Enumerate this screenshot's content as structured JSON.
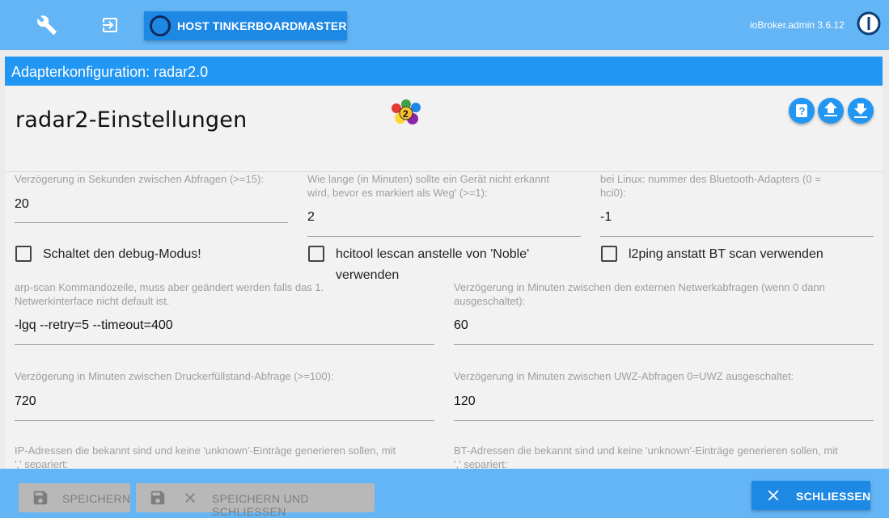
{
  "topbar": {
    "host_label": "HOST TINKERBOARDMASTER",
    "version": "ioBroker.admin 3.6.12",
    "icons": [
      "wrench-icon",
      "logout-icon",
      "iobroker-logo"
    ]
  },
  "page": {
    "title": "Adapterkonfiguration: radar2.0",
    "settings_title": "radar2-Einstellungen",
    "action_icons": [
      "help-icon",
      "upload-icon",
      "download-icon"
    ]
  },
  "fields": {
    "delay": {
      "label": "Verzögerung in Sekunden zwischen Abfragen (>=15):",
      "value": "20"
    },
    "away": {
      "label_l1": "Wie lange (in Minuten) sollte ein Gerät nicht erkannt",
      "label_l2": "wird, bevor es markiert als Weg' (>=1):",
      "value": "2"
    },
    "btadapter": {
      "label_l1": "bei Linux: nummer des Bluetooth-Adapters (0 =",
      "label_l2": "hci0):",
      "value": "-1"
    },
    "arpscan": {
      "label_l1": "arp-scan Kommandozeile, muss aber geändert werden falls das 1.",
      "label_l2": "Netwerkinterface nicht default ist.",
      "value": "-lgq --retry=5 --timeout=400"
    },
    "external": {
      "label_l1": "Verzögerung in Minuten zwischen den externen Netwerkabfragen (wenn 0 dann",
      "label_l2": "ausgeschaltet):",
      "value": "60"
    },
    "printer": {
      "label": "Verzögerung in Minuten zwischen Druckerfüllstand-Abfrage (>=100):",
      "value": "720"
    },
    "uwz": {
      "label": "Verzögerung in Minuten zwischen UWZ-Abfragen 0=UWZ ausgeschaltet:",
      "value": "120"
    },
    "knownip": {
      "label_l1": "IP-Adressen die bekannt sind und keine 'unknown'-Einträge generieren sollen, mit",
      "label_l2": "',' separiert:"
    },
    "knownbt": {
      "label_l1": "BT-Adressen die bekannt sind und keine 'unknown'-Einträge generieren sollen, mit",
      "label_l2": "',' separiert:"
    }
  },
  "checkboxes": {
    "debug": {
      "label": "Schaltet den debug-Modus!",
      "checked": false
    },
    "hcitool": {
      "label_l1": "hcitool lescan anstelle von 'Noble'",
      "label_l2": "verwenden",
      "checked": false
    },
    "l2ping": {
      "label": "l2ping anstatt BT scan verwenden",
      "checked": false
    }
  },
  "bottombar": {
    "save_label": "SPEICHERN",
    "save_close_label": "SPEICHERN UND SCHLIESSEN",
    "close_label": "SCHLIESSEN"
  },
  "colors": {
    "topbar": "#64b5f6",
    "title_bar": "#2196f3",
    "button_primary": "#1e88e5",
    "disabled_button": "#b8b8b8"
  }
}
